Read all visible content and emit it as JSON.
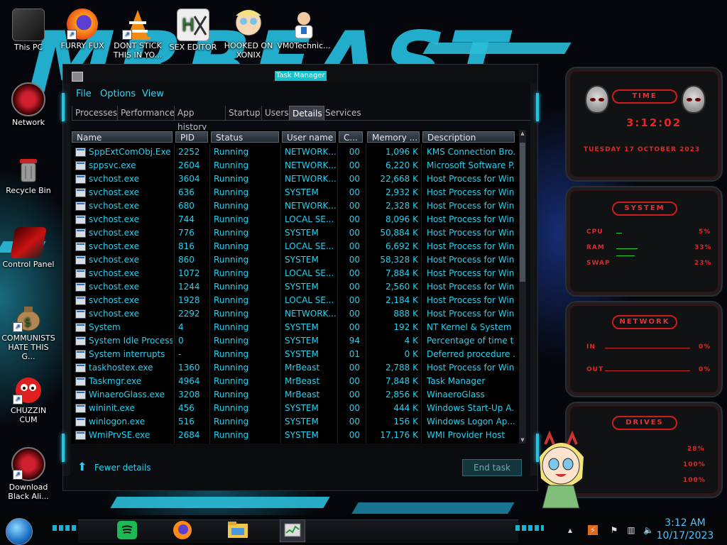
{
  "desktop_icons": [
    {
      "label": "This PC",
      "icon": "computer-icon"
    },
    {
      "label": "FURRY FUX",
      "icon": "firefox-icon"
    },
    {
      "label": "DONT STICK THIS IN YO...",
      "icon": "vlc-icon"
    },
    {
      "label": "SEX EDITOR",
      "icon": "editor-icon"
    },
    {
      "label": "HOOKED ON XONIX",
      "icon": "cartoon-icon"
    },
    {
      "label": "VM0Technic...",
      "icon": "doctor-icon"
    },
    {
      "label": "Network",
      "icon": "network-icon"
    },
    {
      "label": "Recycle Bin",
      "icon": "recycle-bin-icon"
    },
    {
      "label": "Control Panel",
      "icon": "control-panel-icon"
    },
    {
      "label": "COMMUNISTS HATE THIS G...",
      "icon": "money-bag-icon"
    },
    {
      "label": "CHUZZIN CUM",
      "icon": "chuzzle-icon"
    },
    {
      "label": "Download Black Ali...",
      "icon": "alien-download-icon"
    }
  ],
  "task_manager": {
    "title": "Task Manager",
    "menu": [
      "File",
      "Options",
      "View"
    ],
    "tabs": [
      "Processes",
      "Performance",
      "App history",
      "Startup",
      "Users",
      "Details",
      "Services"
    ],
    "active_tab": "Details",
    "columns": [
      "Name",
      "PID",
      "Status",
      "User name",
      "C...",
      "Memory ...",
      "Description"
    ],
    "rows": [
      [
        "SppExtComObj.Exe",
        "2252",
        "Running",
        "NETWORK...",
        "00",
        "1,096 K",
        "KMS Connection Bro..."
      ],
      [
        "sppsvc.exe",
        "2604",
        "Running",
        "NETWORK...",
        "00",
        "6,220 K",
        "Microsoft Software P..."
      ],
      [
        "svchost.exe",
        "3604",
        "Running",
        "NETWORK...",
        "00",
        "22,668 K",
        "Host Process for Win..."
      ],
      [
        "svchost.exe",
        "636",
        "Running",
        "SYSTEM",
        "00",
        "2,932 K",
        "Host Process for Win..."
      ],
      [
        "svchost.exe",
        "680",
        "Running",
        "NETWORK...",
        "00",
        "2,328 K",
        "Host Process for Win..."
      ],
      [
        "svchost.exe",
        "744",
        "Running",
        "LOCAL SE...",
        "00",
        "8,096 K",
        "Host Process for Win..."
      ],
      [
        "svchost.exe",
        "776",
        "Running",
        "SYSTEM",
        "00",
        "50,884 K",
        "Host Process for Win..."
      ],
      [
        "svchost.exe",
        "816",
        "Running",
        "LOCAL SE...",
        "00",
        "6,692 K",
        "Host Process for Win..."
      ],
      [
        "svchost.exe",
        "860",
        "Running",
        "SYSTEM",
        "00",
        "58,328 K",
        "Host Process for Win..."
      ],
      [
        "svchost.exe",
        "1072",
        "Running",
        "LOCAL SE...",
        "00",
        "7,884 K",
        "Host Process for Win..."
      ],
      [
        "svchost.exe",
        "1244",
        "Running",
        "SYSTEM",
        "00",
        "2,560 K",
        "Host Process for Win..."
      ],
      [
        "svchost.exe",
        "1928",
        "Running",
        "LOCAL SE...",
        "00",
        "2,184 K",
        "Host Process for Win..."
      ],
      [
        "svchost.exe",
        "2292",
        "Running",
        "NETWORK...",
        "00",
        "888 K",
        "Host Process for Win..."
      ],
      [
        "System",
        "4",
        "Running",
        "SYSTEM",
        "00",
        "192 K",
        "NT Kernel & System"
      ],
      [
        "System Idle Process",
        "0",
        "Running",
        "SYSTEM",
        "94",
        "4 K",
        "Percentage of time t..."
      ],
      [
        "System interrupts",
        "-",
        "Running",
        "SYSTEM",
        "01",
        "0 K",
        "Deferred procedure ..."
      ],
      [
        "taskhostex.exe",
        "1360",
        "Running",
        "MrBeast",
        "00",
        "2,788 K",
        "Host Process for Win..."
      ],
      [
        "Taskmgr.exe",
        "4964",
        "Running",
        "MrBeast",
        "00",
        "7,848 K",
        "Task Manager"
      ],
      [
        "WinaeroGlass.exe",
        "3208",
        "Running",
        "MrBeast",
        "00",
        "2,856 K",
        "WinaeroGlass"
      ],
      [
        "wininit.exe",
        "456",
        "Running",
        "SYSTEM",
        "00",
        "444 K",
        "Windows Start-Up A..."
      ],
      [
        "winlogon.exe",
        "516",
        "Running",
        "SYSTEM",
        "00",
        "156 K",
        "Windows Logon Ap..."
      ],
      [
        "WmiPrvSE.exe",
        "2684",
        "Running",
        "SYSTEM",
        "00",
        "17,176 K",
        "WMI Provider Host"
      ]
    ],
    "fewer_details": "Fewer details",
    "end_task": "End task"
  },
  "gadgets": {
    "time": {
      "header": "TIME",
      "clock": "3:12:02",
      "date": "TUESDAY 17 OCTOBER 2023"
    },
    "system": {
      "header": "SYSTEM",
      "cpu_label": "CPU",
      "cpu_value": "5%",
      "ram_label": "RAM",
      "ram_value": "33%",
      "swap_label": "SWAP",
      "swap_value": "23%"
    },
    "network": {
      "header": "NETWORK",
      "in_label": "IN",
      "in_value": "0%",
      "out_label": "OUT",
      "out_value": "0%"
    },
    "drives": {
      "header": "DRIVES",
      "values": [
        "28%",
        "100%",
        "100%"
      ]
    }
  },
  "taskbar": {
    "apps": [
      "spotify-icon",
      "firefox-icon",
      "file-explorer-icon",
      "task-manager-icon"
    ],
    "time": "3:12 AM",
    "date": "10/17/2023"
  },
  "colors": {
    "accent": "#23c3e3",
    "text": "#29d0ee",
    "gadget_red": "#e02828"
  }
}
